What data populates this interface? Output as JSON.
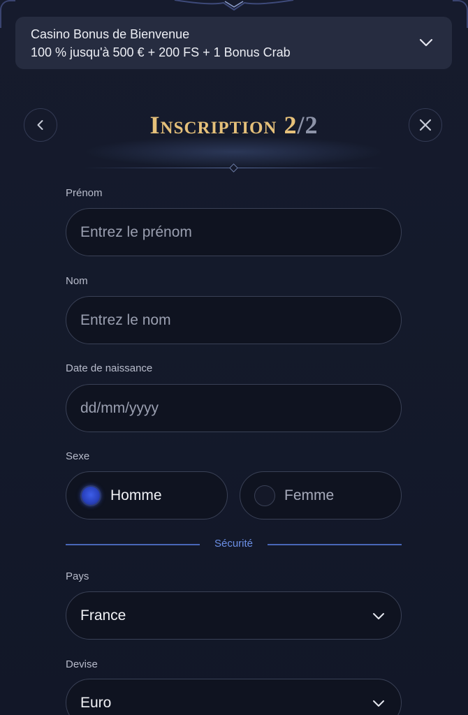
{
  "bonus": {
    "title": "Casino Bonus de Bienvenue",
    "offer": "100 % jusqu'à 500 € + 200 FS + 1 Bonus Crab"
  },
  "header": {
    "title": "Inscription",
    "step_current": "2",
    "step_separator": "/",
    "step_total": "2"
  },
  "form": {
    "first_name": {
      "label": "Prénom",
      "placeholder": "Entrez le prénom"
    },
    "last_name": {
      "label": "Nom",
      "placeholder": "Entrez le nom"
    },
    "birth_date": {
      "label": "Date de naissance",
      "placeholder": "dd/mm/yyyy"
    },
    "gender": {
      "label": "Sexe",
      "options": [
        "Homme",
        "Femme"
      ],
      "selected": "Homme"
    },
    "security_section": "Sécurité",
    "country": {
      "label": "Pays",
      "value": "France"
    },
    "currency": {
      "label": "Devise",
      "value": "Euro"
    }
  },
  "colors": {
    "background": "#151a2b",
    "banner": "#262c40",
    "title_gold": "#e5c07a",
    "accent_blue": "#6c8fe6",
    "input_bg": "#0f1320"
  },
  "icons": {
    "banner_toggle": "chevron-down-icon",
    "back": "chevron-left-icon",
    "close": "close-icon",
    "select": "chevron-down-icon"
  }
}
